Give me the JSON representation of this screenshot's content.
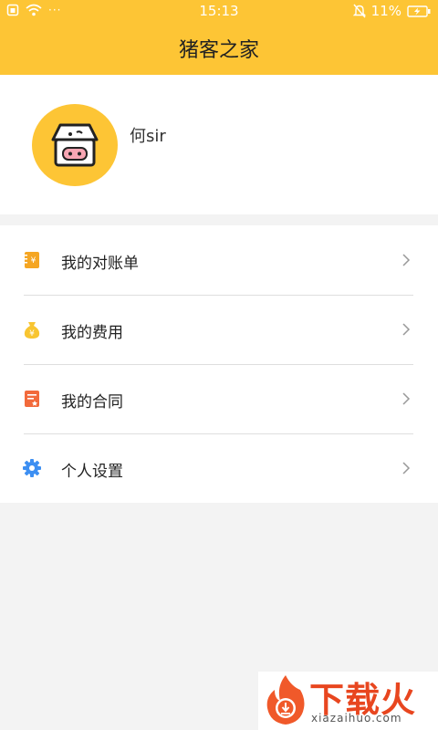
{
  "status_bar": {
    "time": "15:13",
    "battery": "11%",
    "dots": "···"
  },
  "header": {
    "title": "猪客之家"
  },
  "profile": {
    "username": "何sir"
  },
  "menu": {
    "items": [
      {
        "label": "我的对账单",
        "icon": "bill-icon"
      },
      {
        "label": "我的费用",
        "icon": "money-bag-icon"
      },
      {
        "label": "我的合同",
        "icon": "contract-icon"
      },
      {
        "label": "个人设置",
        "icon": "gear-icon"
      }
    ]
  },
  "watermark": {
    "brand": "下载火",
    "url": "xiazaihuo.com"
  },
  "colors": {
    "accent": "#fdc535",
    "bill_icon": "#f5a623",
    "money_icon": "#f8c531",
    "contract_icon": "#f26a3b",
    "gear_icon": "#3d8ff2",
    "watermark": "#e8461f"
  }
}
